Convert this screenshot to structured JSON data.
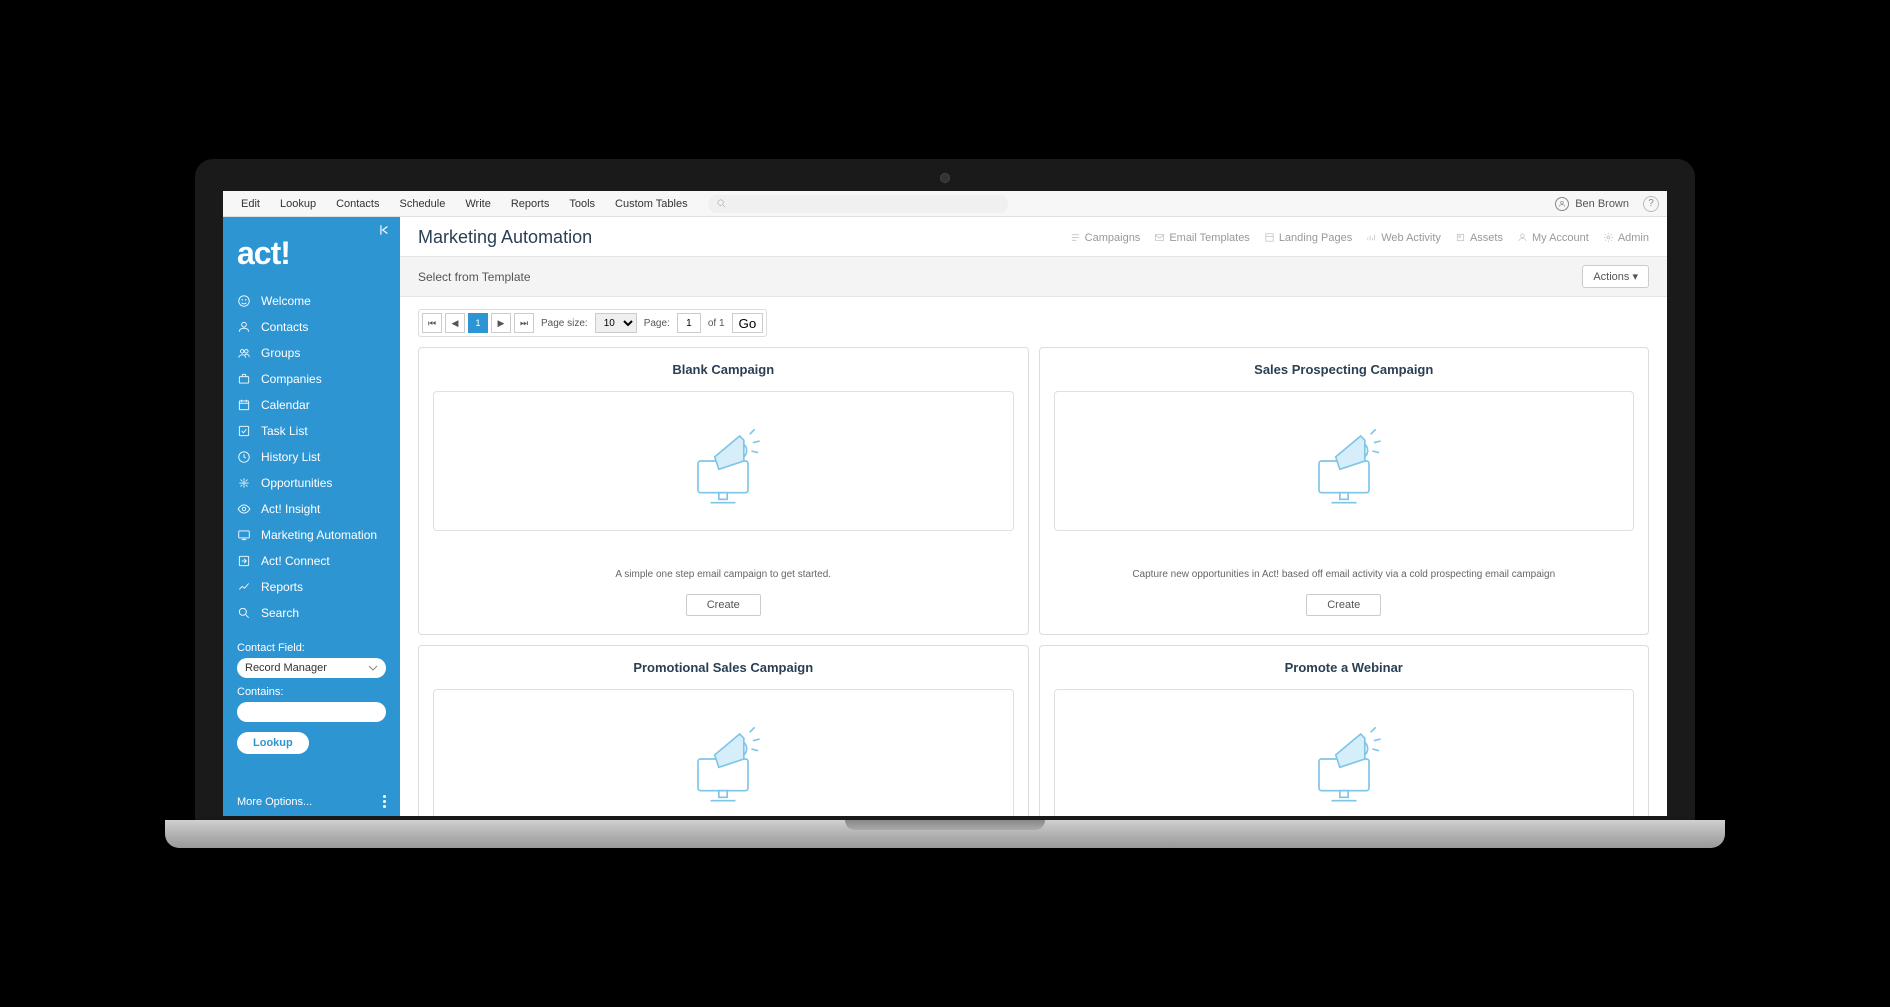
{
  "topMenu": [
    "Edit",
    "Lookup",
    "Contacts",
    "Schedule",
    "Write",
    "Reports",
    "Tools",
    "Custom Tables"
  ],
  "user": {
    "name": "Ben Brown"
  },
  "logo": "act!",
  "sidebar": {
    "items": [
      {
        "icon": "smile",
        "label": "Welcome"
      },
      {
        "icon": "user",
        "label": "Contacts"
      },
      {
        "icon": "users",
        "label": "Groups"
      },
      {
        "icon": "briefcase",
        "label": "Companies"
      },
      {
        "icon": "calendar",
        "label": "Calendar"
      },
      {
        "icon": "check",
        "label": "Task List"
      },
      {
        "icon": "clock",
        "label": "History List"
      },
      {
        "icon": "opps",
        "label": "Opportunities"
      },
      {
        "icon": "eye",
        "label": "Act! Insight"
      },
      {
        "icon": "monitor",
        "label": "Marketing Automation"
      },
      {
        "icon": "connect",
        "label": "Act! Connect"
      },
      {
        "icon": "chart",
        "label": "Reports"
      },
      {
        "icon": "search",
        "label": "Search"
      }
    ],
    "lookup": {
      "fieldLabel": "Contact Field:",
      "fieldValue": "Record Manager",
      "containsLabel": "Contains:",
      "containsValue": "",
      "button": "Lookup",
      "more": "More Options..."
    }
  },
  "page": {
    "title": "Marketing Automation",
    "subnav": [
      "Campaigns",
      "Email Templates",
      "Landing Pages",
      "Web Activity",
      "Assets",
      "My Account",
      "Admin"
    ],
    "templateBar": "Select from Template",
    "actions": "Actions"
  },
  "pager": {
    "pageSizeLabel": "Page size:",
    "pageSize": "10",
    "pageLabel": "Page:",
    "pageNum": "1",
    "ofTotal": "of 1",
    "go": "Go",
    "current": "1"
  },
  "cards": [
    {
      "title": "Blank Campaign",
      "desc": "A simple one step email campaign to get started.",
      "create": "Create"
    },
    {
      "title": "Sales Prospecting Campaign",
      "desc": "Capture new opportunities in Act! based off email activity via a cold prospecting email campaign",
      "create": "Create"
    },
    {
      "title": "Promotional Sales Campaign",
      "desc": "",
      "create": ""
    },
    {
      "title": "Promote a Webinar",
      "desc": "",
      "create": ""
    }
  ]
}
